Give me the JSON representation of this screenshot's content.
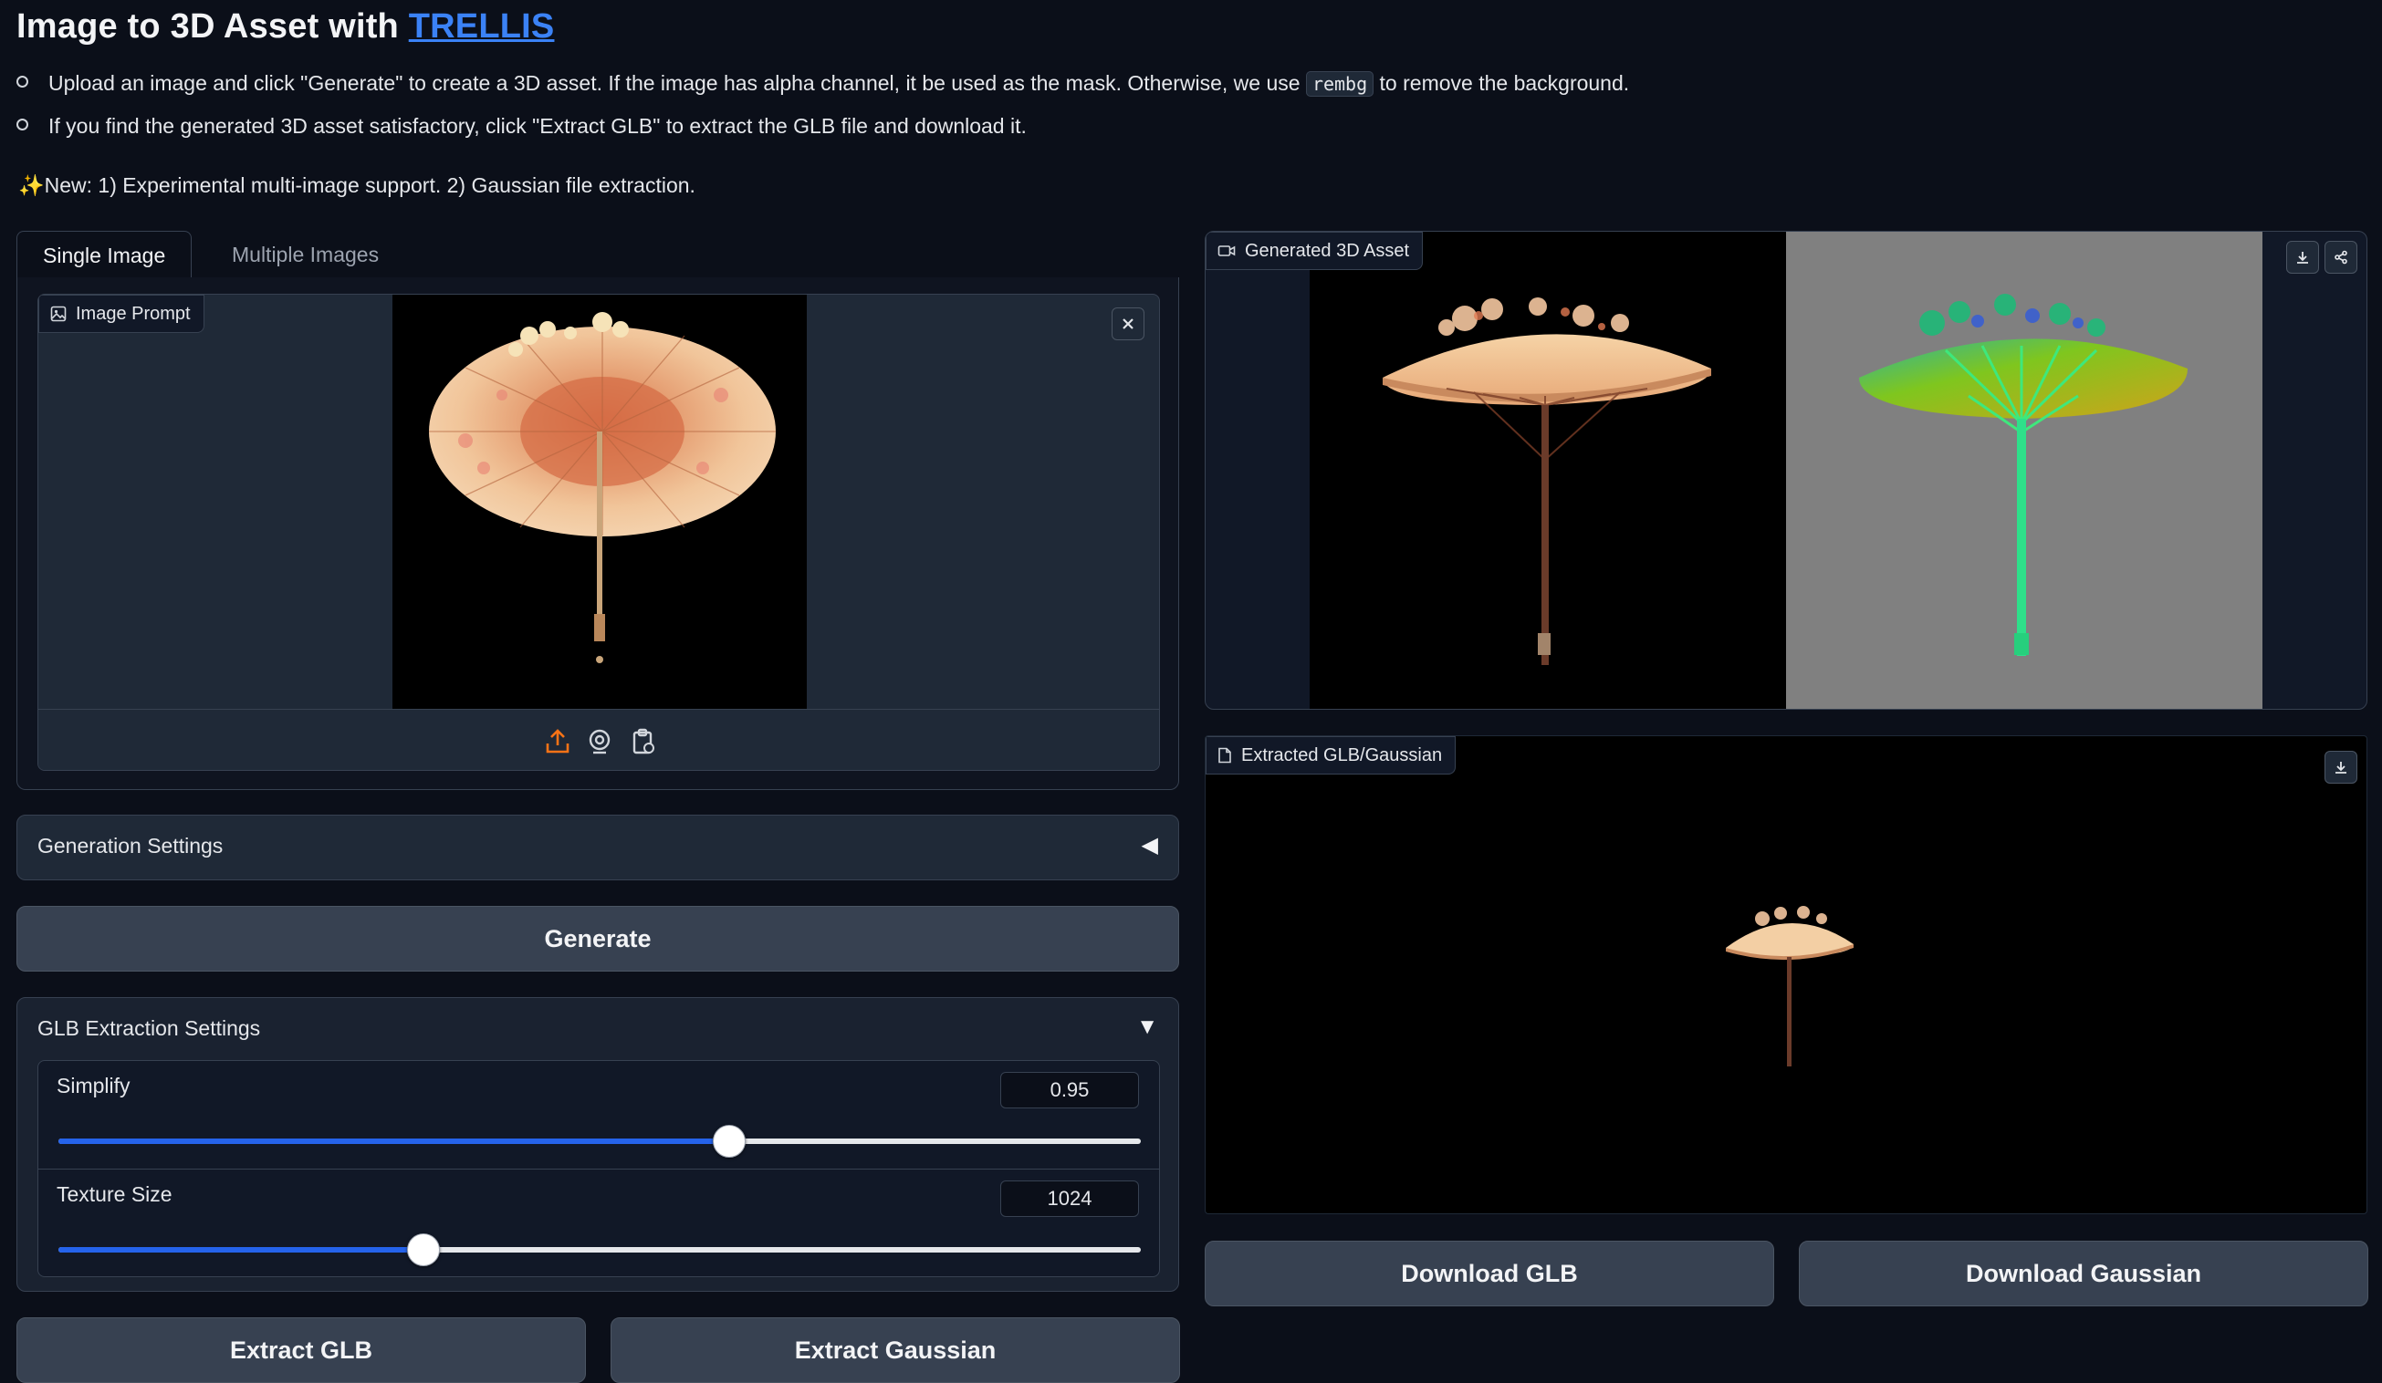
{
  "header": {
    "title_prefix": "Image to 3D Asset with ",
    "title_link": "TRELLIS",
    "bullet1_pre": "Upload an image and click \"Generate\" to create a 3D asset. If the image has alpha channel, it be used as the mask. Otherwise, we use ",
    "bullet1_code": "rembg",
    "bullet1_post": " to remove the background.",
    "bullet2": "If you find the generated 3D asset satisfactory, click \"Extract GLB\" to extract the GLB file and download it.",
    "news": "✨New: 1) Experimental multi-image support. 2) Gaussian file extraction."
  },
  "tabs": [
    {
      "label": "Single Image",
      "active": true
    },
    {
      "label": "Multiple Images",
      "active": false
    }
  ],
  "image_prompt": {
    "label": "Image Prompt"
  },
  "generation_settings": {
    "label": "Generation Settings",
    "collapsed_icon": "◀"
  },
  "generate_button": "Generate",
  "glb_settings": {
    "label": "GLB Extraction Settings",
    "expanded_icon": "▼",
    "simplify": {
      "label": "Simplify",
      "value": "0.95",
      "fraction": 0.62
    },
    "texture_size": {
      "label": "Texture Size",
      "value": "1024",
      "fraction": 0.337
    }
  },
  "buttons": {
    "extract_glb": "Extract GLB",
    "extract_gaussian": "Extract Gaussian",
    "download_glb": "Download GLB",
    "download_gaussian": "Download Gaussian"
  },
  "generated_asset": {
    "label": "Generated 3D Asset"
  },
  "extracted": {
    "label": "Extracted GLB/Gaussian"
  },
  "icons": [
    "upload-icon",
    "webcam-icon",
    "clipboard-icon",
    "close-icon",
    "download-icon",
    "share-icon",
    "video-icon",
    "file-icon",
    "image-icon"
  ],
  "colors": {
    "accent": "#2563eb",
    "link": "#3b82f6",
    "upload_icon": "#f97316",
    "background": "#0b0f19"
  }
}
